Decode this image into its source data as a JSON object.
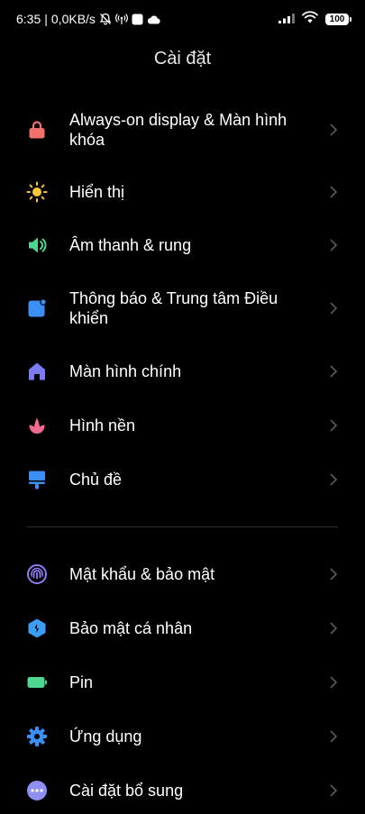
{
  "status_bar": {
    "time": "6:35",
    "separator": "|",
    "speed": "0,0KB/s",
    "battery": "100"
  },
  "header": {
    "title": "Cài đặt"
  },
  "settings": {
    "group1": [
      {
        "label": "Always-on display & Màn hình khóa",
        "icon": "lock-icon",
        "color": "#f2706b"
      },
      {
        "label": "Hiển thị",
        "icon": "sun-icon",
        "color": "#f9c63d"
      },
      {
        "label": "Âm thanh & rung",
        "icon": "speaker-icon",
        "color": "#4fd68e"
      },
      {
        "label": "Thông báo & Trung tâm Điều khiển",
        "icon": "notification-icon",
        "color": "#3b8ff5"
      },
      {
        "label": "Màn hình chính",
        "icon": "home-icon",
        "color": "#7b7cf5"
      },
      {
        "label": "Hình nền",
        "icon": "flower-icon",
        "color": "#f26a8d"
      },
      {
        "label": "Chủ đề",
        "icon": "brush-icon",
        "color": "#3b8ff5"
      }
    ],
    "group2": [
      {
        "label": "Mật khẩu & bảo mật",
        "icon": "fingerprint-icon",
        "color": "#8e7cf5"
      },
      {
        "label": "Bảo mật cá nhân",
        "icon": "privacy-shield-icon",
        "color": "#3b9ef5"
      },
      {
        "label": "Pin",
        "icon": "battery-icon",
        "color": "#4fd68e"
      },
      {
        "label": "Ứng dụng",
        "icon": "gear-icon",
        "color": "#3b8ff5"
      },
      {
        "label": "Cài đặt bổ sung",
        "icon": "more-icon",
        "color": "#8e8ef5"
      }
    ]
  }
}
